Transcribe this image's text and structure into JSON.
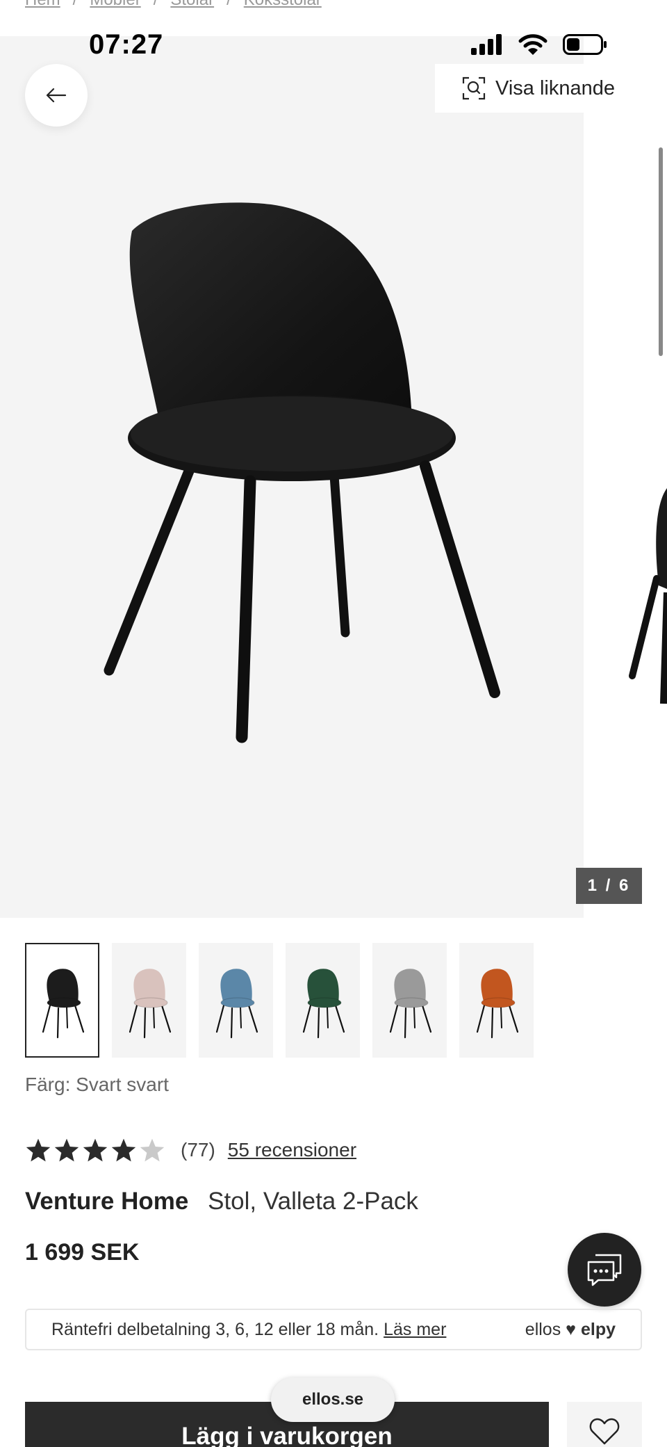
{
  "breadcrumb": {
    "items": [
      "Hem",
      "Möbler",
      "Stolar",
      "Köksstolar"
    ],
    "separator": "/"
  },
  "status_bar": {
    "time": "07:27"
  },
  "header": {
    "similar_label": "Visa liknande"
  },
  "gallery": {
    "counter": "1 / 6"
  },
  "colors": [
    {
      "name": "Svart",
      "hex": "#1c1c1c"
    },
    {
      "name": "Rosa",
      "hex": "#d9c2bd"
    },
    {
      "name": "Blå",
      "hex": "#5b87a8"
    },
    {
      "name": "Grön",
      "hex": "#27513a"
    },
    {
      "name": "Grå",
      "hex": "#9a9a9a"
    },
    {
      "name": "Orange",
      "hex": "#c2561f"
    }
  ],
  "product": {
    "color_label": "Färg: Svart svart",
    "rating": 4,
    "rating_max": 5,
    "rating_count": "(77)",
    "reviews_link": "55 recensioner",
    "brand": "Venture Home",
    "name": "Stol, Valleta 2-Pack",
    "price": "1 699 SEK"
  },
  "installment": {
    "text": "Räntefri delbetalning 3, 6, 12 eller 18 mån.",
    "link": "Läs mer",
    "brand_ellos": "ellos",
    "brand_heart": "♥",
    "brand_elpy": "elpy"
  },
  "actions": {
    "add_to_cart": "Lägg i varukorgen"
  },
  "browser": {
    "url": "ellos.se"
  }
}
